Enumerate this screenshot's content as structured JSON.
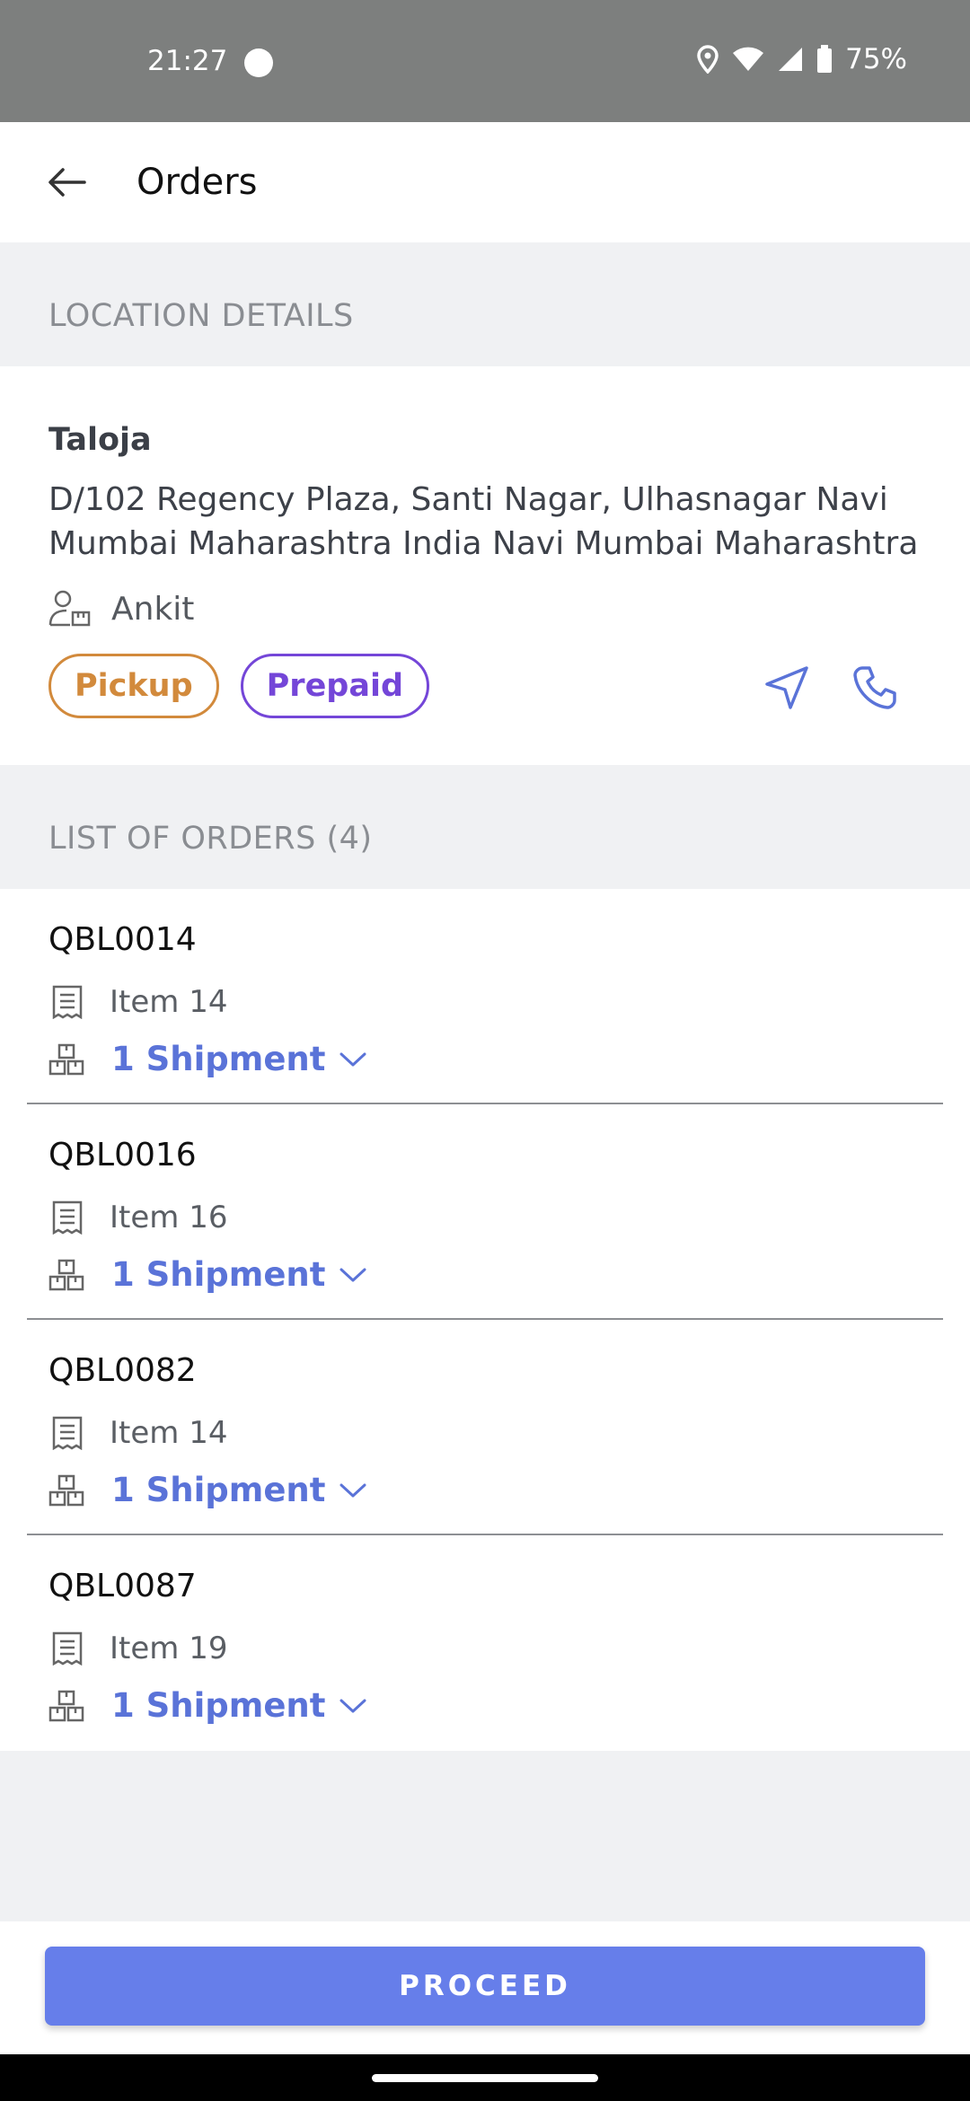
{
  "status_bar": {
    "time": "21:27",
    "battery": "75%"
  },
  "header": {
    "title": "Orders"
  },
  "location_section": {
    "heading": "LOCATION DETAILS"
  },
  "location": {
    "name": "Taloja",
    "address": "D/102 Regency Plaza, Santi Nagar, Ulhasnagar  Navi Mumbai Maharashtra India Navi Mumbai Maharashtra",
    "contact": "Ankit",
    "tags": [
      "Pickup",
      "Prepaid"
    ],
    "tag_colors": {
      "pickup": "#d28a3c",
      "prepaid": "#7446d8"
    }
  },
  "orders_section": {
    "heading": "LIST OF ORDERS (4)"
  },
  "orders": [
    {
      "id": "QBL0014",
      "item": "Item 14",
      "shipment": "1 Shipment"
    },
    {
      "id": "QBL0016",
      "item": "Item 16",
      "shipment": "1 Shipment"
    },
    {
      "id": "QBL0082",
      "item": "Item 14",
      "shipment": "1 Shipment"
    },
    {
      "id": "QBL0087",
      "item": "Item 19",
      "shipment": "1 Shipment"
    }
  ],
  "footer": {
    "proceed_label": "PROCEED"
  },
  "colors": {
    "accent": "#667eea",
    "link": "#5a73d8"
  },
  "icons": {
    "back": "arrow-left-icon",
    "contact": "person-package-icon",
    "navigate": "navigation-arrow-icon",
    "call": "phone-icon",
    "item": "receipt-icon",
    "shipment": "boxes-icon",
    "expand": "chevron-down-icon"
  }
}
